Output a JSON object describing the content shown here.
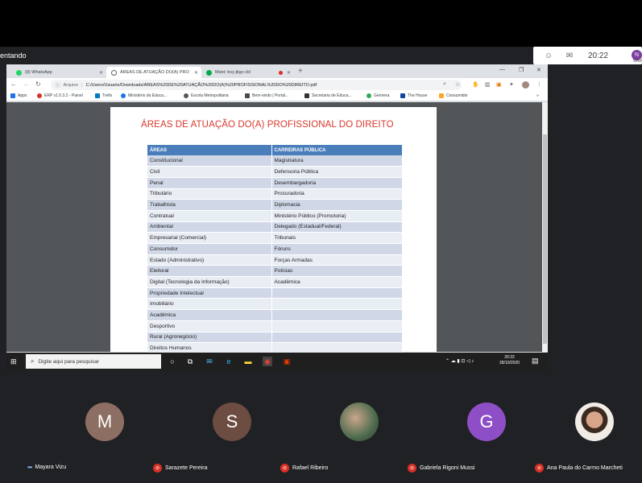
{
  "meet": {
    "presenting_text": "entando",
    "clock": "20:22",
    "self_initial": "N",
    "self_label": "Você"
  },
  "browser": {
    "tabs": [
      {
        "label": "(8) WhatsApp",
        "active": false
      },
      {
        "label": "ÁREAS DE ATUAÇÃO DO(A) PRO",
        "active": true
      },
      {
        "label": "Meet: bvy-jkgc-ckl",
        "active": false
      }
    ],
    "new_tab": "+",
    "address_label": "Arquivo",
    "url": "C:/Users/Usuario/Downloads/ÁREAS%20DE%20ATUAÇÃO%20DO(A)%20PROFISSIONAL%20DO%20DIREITO.pdf",
    "bookmarks": [
      "Apps",
      "ERP v1.0.3.2 - Painel",
      "Trello",
      "Ministério da Educa...",
      "Escola Metropolitana",
      "Bem-vindo | Portal...",
      "Secretaria de Educa...",
      "Gennera",
      "The House",
      "Consumidor"
    ]
  },
  "document": {
    "title": "ÁREAS DE ATUAÇÃO DO(A) PROFISSIONAL DO DIREITO",
    "headers": [
      "ÁREAS",
      "CARREIRAS PÚBLICA"
    ],
    "rows": [
      [
        "Constitucional",
        "Magistratura"
      ],
      [
        "Civil",
        "Defensoria Pública"
      ],
      [
        "Penal",
        "Desembargadoria"
      ],
      [
        "Tributário",
        "Procuradoria"
      ],
      [
        "Trabalhista",
        "Diplomacia"
      ],
      [
        "Contratual",
        "Ministério Público (Promotoria)"
      ],
      [
        "Ambiental",
        "Delegado (Estadual/Federal)"
      ],
      [
        "Empresarial (Comercial)",
        "Tribunais"
      ],
      [
        "Consumidor",
        "Fóruns"
      ],
      [
        "Estado (Administrativo)",
        "Forças Armadas"
      ],
      [
        "Eleitoral",
        "Polícias"
      ],
      [
        "Digital (Tecnologia da Informação)",
        "Acadêmica"
      ],
      [
        "Propriedade Intelectual",
        ""
      ],
      [
        "Imobiliário",
        ""
      ],
      [
        "Acadêmica",
        ""
      ],
      [
        "Desportivo",
        ""
      ],
      [
        "Rural (Agronegócio)",
        ""
      ],
      [
        "Direitos Humanos",
        ""
      ]
    ]
  },
  "taskbar": {
    "search_placeholder": "Digite aqui para pesquisar",
    "time": "20:22",
    "date": "28/10/2020"
  },
  "participants": [
    {
      "name": "Mayara Vizu",
      "initial": "M",
      "color": "#8d6e63",
      "muted": false
    },
    {
      "name": "Sarazete Pereira",
      "initial": "S",
      "color": "#6d4c41",
      "muted": true
    },
    {
      "name": "Rafael Ribeiro",
      "initial": "",
      "color": "#5a7a5a",
      "muted": true
    },
    {
      "name": "Gabriela Rigoni Mussi",
      "initial": "G",
      "color": "#8e4ec6",
      "muted": true
    },
    {
      "name": "Ana Paula do Carmo Marcheti",
      "initial": "",
      "color": "#e8e0d8",
      "muted": true
    }
  ]
}
